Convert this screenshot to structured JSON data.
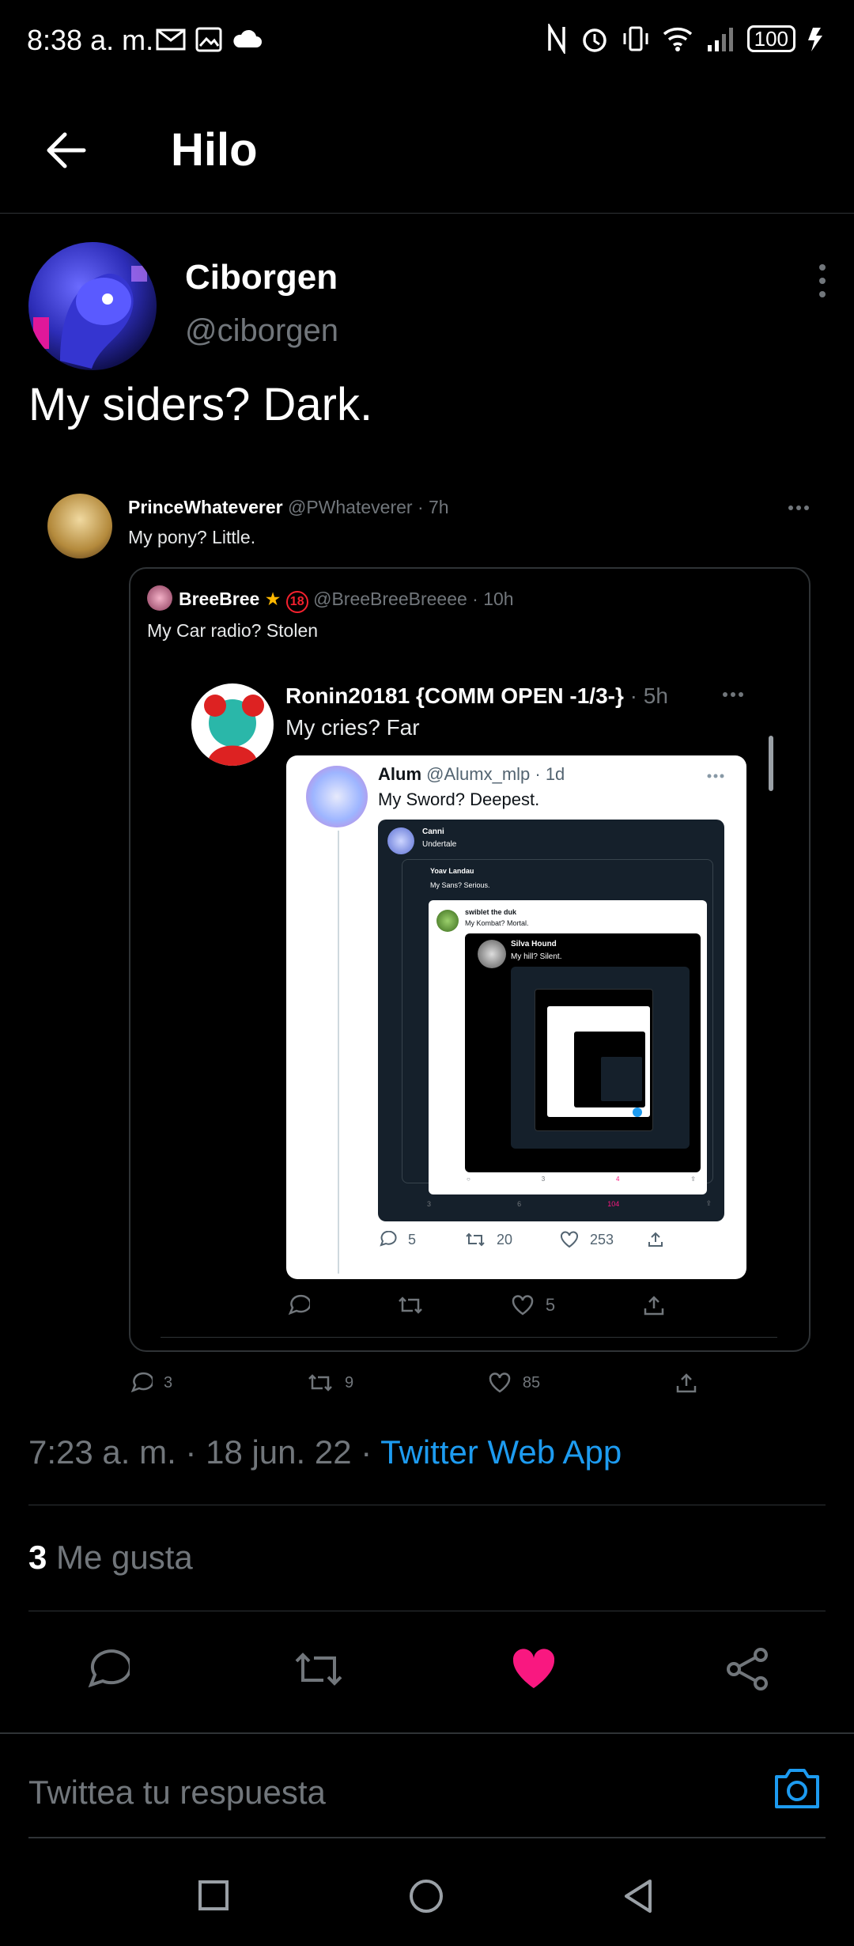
{
  "status_bar": {
    "time": "8:38 a. m.",
    "battery": "100"
  },
  "header": {
    "title": "Hilo"
  },
  "tweet": {
    "author_name": "Ciborgen",
    "author_handle": "@ciborgen",
    "text": "My siders? Dark.",
    "timestamp": "7:23 a. m. · 18 jun. 22 · ",
    "client": "Twitter Web App",
    "likes_count": "3",
    "likes_label": "Me gusta"
  },
  "quote1": {
    "name": "PrinceWhateverer",
    "handle": "@PWhateverer · 7h",
    "text": "My pony? Little.",
    "replies": "3",
    "retweets": "9",
    "likes": "85"
  },
  "quote2": {
    "name": "BreeBree",
    "badge": "18",
    "handle": "@BreeBreeBreeee · 10h",
    "text": "My Car radio? Stolen",
    "likes": "5"
  },
  "quote3": {
    "name": "Ronin20181 {COMM OPEN -1/3-}",
    "handle": "· 5h",
    "text": "My cries? Far"
  },
  "quote4": {
    "name": "Alum",
    "handle": "@Alumx_mlp · 1d",
    "text": "My Sword? Deepest.",
    "replies": "5",
    "retweets": "20",
    "likes": "253"
  },
  "quote5": {
    "name": "Canni",
    "text": "Undertale",
    "sub_name": "Yoav Landau",
    "sub_text": "My Sans? Serious.",
    "sub2_name": "swiblet the duk",
    "sub2_text": "My Kombat? Mortal.",
    "sub3_name": "Silva Hound",
    "sub3_text": "My hill? Silent.",
    "r1": "3",
    "rt1": "6",
    "l1": "104",
    "r2": "3",
    "l2": "4"
  },
  "reply": {
    "placeholder": "Twittea tu respuesta"
  },
  "colors": {
    "accent": "#1d9bf0",
    "like": "#f91880",
    "muted": "#71767b"
  }
}
